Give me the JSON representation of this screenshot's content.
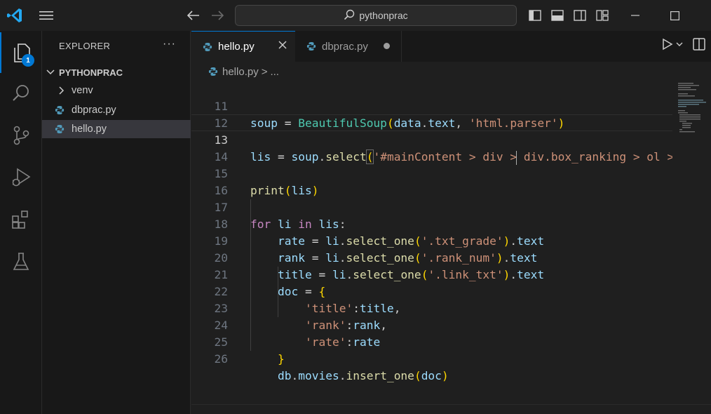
{
  "titlebar": {
    "search_text": "pythonprac",
    "icons": [
      "vscode-logo-icon",
      "hamburger-menu-icon",
      "back-arrow-icon",
      "forward-arrow-icon",
      "search-icon",
      "toggle-primary-sidebar-icon",
      "toggle-panel-icon",
      "toggle-secondary-sidebar-icon",
      "customize-layout-icon",
      "minimize-icon",
      "maximize-icon"
    ]
  },
  "activity_bar": {
    "items": [
      "explorer-icon",
      "search-icon",
      "source-control-icon",
      "run-debug-icon",
      "extensions-icon",
      "testing-icon"
    ],
    "explorer_badge": "1"
  },
  "sidebar": {
    "header": "EXPLORER",
    "more": "···",
    "folder": "PYTHONPRAC",
    "items": [
      {
        "label": "venv",
        "type": "folder"
      },
      {
        "label": "dbprac.py",
        "type": "python"
      },
      {
        "label": "hello.py",
        "type": "python",
        "selected": true
      }
    ]
  },
  "tabs": [
    {
      "label": "hello.py",
      "active": true,
      "state": "close"
    },
    {
      "label": "dbprac.py",
      "active": false,
      "state": "modified-dot"
    }
  ],
  "breadcrumb": {
    "file": "hello.py",
    "separator": ">",
    "tail": "..."
  },
  "editor": {
    "current_line": "13",
    "lines": [
      {
        "num": "11",
        "code": "soup = BeautifulSoup(data.text, 'html.parser')"
      },
      {
        "num": "12",
        "code": ""
      },
      {
        "num": "13",
        "code": "lis = soup.select('#mainContent > div > div.box_ranking > ol > "
      },
      {
        "num": "14",
        "code": ""
      },
      {
        "num": "15",
        "code": "print(lis)"
      },
      {
        "num": "16",
        "code": ""
      },
      {
        "num": "17",
        "code": "for li in lis:"
      },
      {
        "num": "18",
        "code": "    rate = li.select_one('.txt_grade').text"
      },
      {
        "num": "19",
        "code": "    rank = li.select_one('.rank_num').text"
      },
      {
        "num": "20",
        "code": "    title = li.select_one('.link_txt').text"
      },
      {
        "num": "21",
        "code": "    doc = {"
      },
      {
        "num": "22",
        "code": "        'title':title,"
      },
      {
        "num": "23",
        "code": "        'rank':rank,"
      },
      {
        "num": "24",
        "code": "        'rate':rate"
      },
      {
        "num": "25",
        "code": "    }"
      },
      {
        "num": "26",
        "code": "    db.movies.insert_one(doc)"
      }
    ]
  },
  "colors": {
    "accent": "#0078d4",
    "variable": "#9cdcfe",
    "function": "#dcdcaa",
    "class": "#4ec9b0",
    "string": "#ce9178",
    "keyword": "#c586c0",
    "bracket1": "#ffd700",
    "bracket2": "#da70d6",
    "bracket3": "#179fff"
  }
}
